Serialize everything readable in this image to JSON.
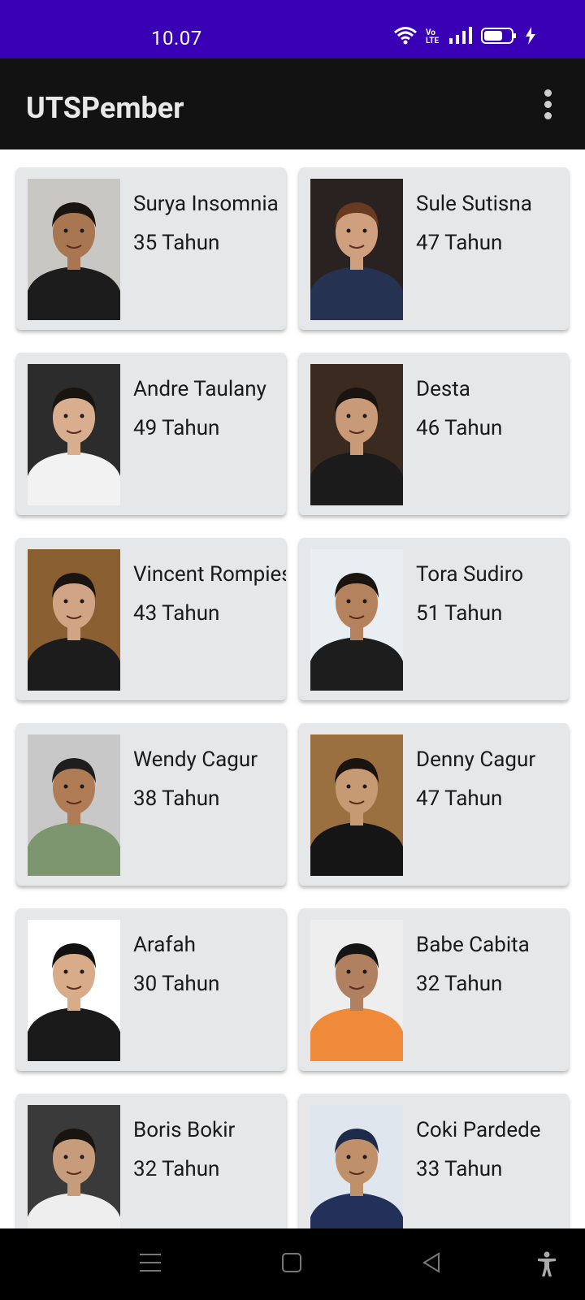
{
  "status_bar": {
    "time": "10.07",
    "volte": "Vo LTE"
  },
  "app_bar": {
    "title": "UTSPember"
  },
  "people": [
    {
      "name": "Surya Insomnia",
      "age": "35 Tahun",
      "bg": "#c9c7c3",
      "skin": "#a87752",
      "shirt": "#1c1c1c",
      "hair": "#1a1410"
    },
    {
      "name": "Sule Sutisna",
      "age": "47 Tahun",
      "bg": "#2a2220",
      "skin": "#d0a07e",
      "shirt": "#263252",
      "hair": "#6a3a20"
    },
    {
      "name": "Andre Taulany",
      "age": "49 Tahun",
      "bg": "#2c2c2c",
      "skin": "#d8ae8e",
      "shirt": "#f2f2f2",
      "hair": "#1a1410"
    },
    {
      "name": "Desta",
      "age": "46 Tahun",
      "bg": "#3b2a20",
      "skin": "#c99a78",
      "shirt": "#1b1b1b",
      "hair": "#1a1410"
    },
    {
      "name": "Vincent Rompies",
      "age": "43 Tahun",
      "bg": "#8a6032",
      "skin": "#d2a486",
      "shirt": "#1c1c1c",
      "hair": "#1a1410"
    },
    {
      "name": "Tora Sudiro",
      "age": "51 Tahun",
      "bg": "#e9eef2",
      "skin": "#b4835e",
      "shirt": "#1d1d1d",
      "hair": "#1a1410"
    },
    {
      "name": "Wendy Cagur",
      "age": "38 Tahun",
      "bg": "#c8c8c8",
      "skin": "#b07c56",
      "shirt": "#7d9670",
      "hair": "#1e1e1e"
    },
    {
      "name": "Denny Cagur",
      "age": "47 Tahun",
      "bg": "#9a7040",
      "skin": "#c69a72",
      "shirt": "#151515",
      "hair": "#1a1410"
    },
    {
      "name": "Arafah",
      "age": "30 Tahun",
      "bg": "#ffffff",
      "skin": "#d8ac88",
      "shirt": "#1a1a1a",
      "hair": "#111111"
    },
    {
      "name": "Babe Cabita",
      "age": "32 Tahun",
      "bg": "#eeeeee",
      "skin": "#b08060",
      "shirt": "#ee8a3a",
      "hair": "#141414"
    },
    {
      "name": "Boris Bokir",
      "age": "32 Tahun",
      "bg": "#3a3a3a",
      "skin": "#c79c7a",
      "shirt": "#eeeeee",
      "hair": "#1a1410"
    },
    {
      "name": "Coki Pardede",
      "age": "33 Tahun",
      "bg": "#dfe6ee",
      "skin": "#c0906a",
      "shirt": "#22305a",
      "hair": "#1e2a4a"
    }
  ]
}
